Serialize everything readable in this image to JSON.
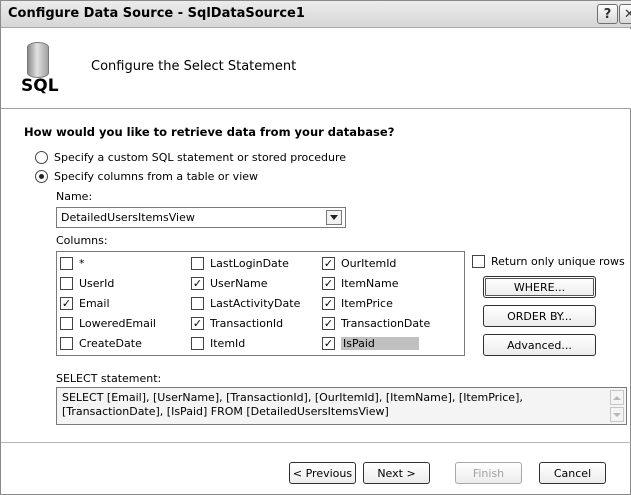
{
  "window": {
    "title": "Configure Data Source - SqlDataSource1",
    "help_glyph": "?",
    "close_glyph": "✕"
  },
  "header": {
    "icon_text": "SQL",
    "heading": "Configure the Select Statement"
  },
  "question": "How would you like to retrieve data from your database?",
  "options": [
    {
      "label": "Specify a custom SQL statement or stored procedure",
      "selected": false
    },
    {
      "label": "Specify columns from a table or view",
      "selected": true
    }
  ],
  "name_label": "Name:",
  "name_value": "DetailedUsersItemsView",
  "columns_label": "Columns:",
  "columns": [
    {
      "label": "*",
      "checked": false
    },
    {
      "label": "UserId",
      "checked": false
    },
    {
      "label": "Email",
      "checked": true
    },
    {
      "label": "LoweredEmail",
      "checked": false
    },
    {
      "label": "CreateDate",
      "checked": false
    },
    {
      "label": "LastLoginDate",
      "checked": false
    },
    {
      "label": "UserName",
      "checked": true
    },
    {
      "label": "LastActivityDate",
      "checked": false
    },
    {
      "label": "TransactionId",
      "checked": true
    },
    {
      "label": "ItemId",
      "checked": false
    },
    {
      "label": "OurItemId",
      "checked": true
    },
    {
      "label": "ItemName",
      "checked": true
    },
    {
      "label": "ItemPrice",
      "checked": true
    },
    {
      "label": "TransactionDate",
      "checked": true
    },
    {
      "label": "IsPaid",
      "checked": true
    }
  ],
  "unique_rows_label": "Return only unique rows",
  "unique_rows_checked": false,
  "buttons": {
    "where": "WHERE...",
    "order_by": "ORDER BY...",
    "advanced": "Advanced..."
  },
  "select_label": "SELECT statement:",
  "select_statement": "SELECT [Email], [UserName], [TransactionId], [OurItemId], [ItemName], [ItemPrice], [TransactionDate], [IsPaid] FROM [DetailedUsersItemsView]",
  "nav": {
    "previous": "< Previous",
    "next": "Next >",
    "finish": "Finish",
    "cancel": "Cancel"
  },
  "check_glyph": "✓"
}
